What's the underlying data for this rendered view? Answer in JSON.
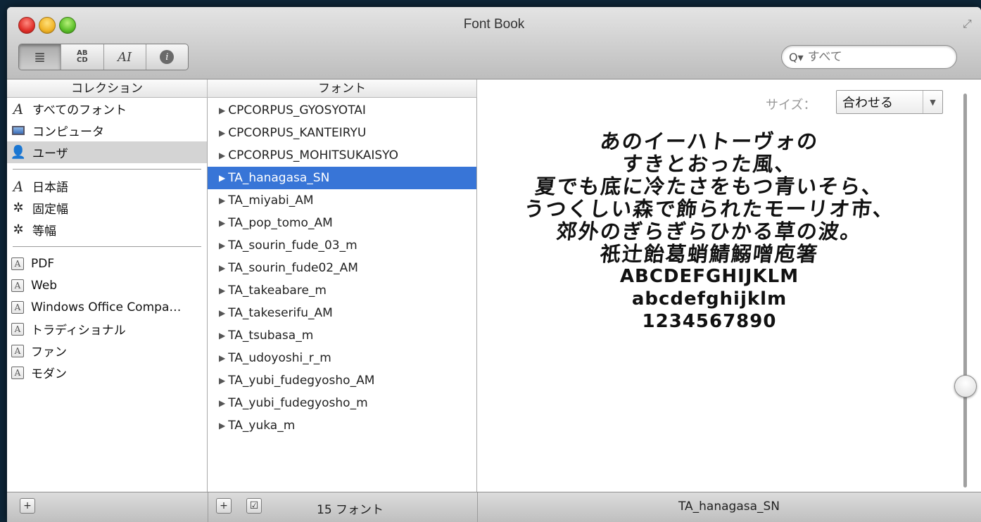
{
  "window": {
    "title": "Font Book"
  },
  "toolbar": {
    "view_buttons": [
      {
        "name": "list-view",
        "label": "≣"
      },
      {
        "name": "sample-view",
        "label": "AB\nCD"
      },
      {
        "name": "custom-view",
        "label": "AI"
      },
      {
        "name": "info-view",
        "label": "i"
      }
    ],
    "search": {
      "placeholder": "すべて"
    }
  },
  "collections": {
    "header": "コレクション",
    "items": [
      {
        "label": "すべてのフォント",
        "icon": "font-script-icon"
      },
      {
        "label": "コンピュータ",
        "icon": "computer-icon"
      },
      {
        "label": "ユーザ",
        "icon": "user-icon",
        "selected": true
      },
      {
        "label": "日本語",
        "icon": "font-script-icon"
      },
      {
        "label": "固定幅",
        "icon": "gear-icon"
      },
      {
        "label": "等幅",
        "icon": "gear-icon"
      },
      {
        "label": "PDF",
        "icon": "font-box-icon"
      },
      {
        "label": "Web",
        "icon": "font-box-icon"
      },
      {
        "label": "Windows Office Compa…",
        "icon": "font-box-icon"
      },
      {
        "label": "トラディショナル",
        "icon": "font-box-icon"
      },
      {
        "label": "ファン",
        "icon": "font-box-icon"
      },
      {
        "label": "モダン",
        "icon": "font-box-icon"
      }
    ]
  },
  "fonts": {
    "header": "フォント",
    "items": [
      "CPCORPUS_GYOSYOTAI",
      "CPCORPUS_KANTEIRYU",
      "CPCORPUS_MOHITSUKAISYO",
      "TA_hanagasa_SN",
      "TA_miyabi_AM",
      "TA_pop_tomo_AM",
      "TA_sourin_fude_03_m",
      "TA_sourin_fude02_AM",
      "TA_takeabare_m",
      "TA_takeserifu_AM",
      "TA_tsubasa_m",
      "TA_udoyoshi_r_m",
      "TA_yubi_fudegyosho_AM",
      "TA_yubi_fudegyosho_m",
      "TA_yuka_m"
    ],
    "selected_index": 3
  },
  "preview": {
    "size_label": "サイズ：",
    "size_value": "合わせる",
    "sample_lines": [
      "あのイーハトーヴォの",
      "すきとおった風、",
      "夏でも底に冷たさをもつ青いそら、",
      "うつくしい森で飾られたモーリオ市、",
      "郊外のぎらぎらひかる草の波。",
      "祇辻飴葛蛸鯖鰯噌庖箸",
      "ABCDEFGHIJKLM",
      "abcdefghijklm",
      "1234567890"
    ]
  },
  "footer": {
    "font_count": "15 フォント",
    "selected_font": "TA_hanagasa_SN"
  }
}
